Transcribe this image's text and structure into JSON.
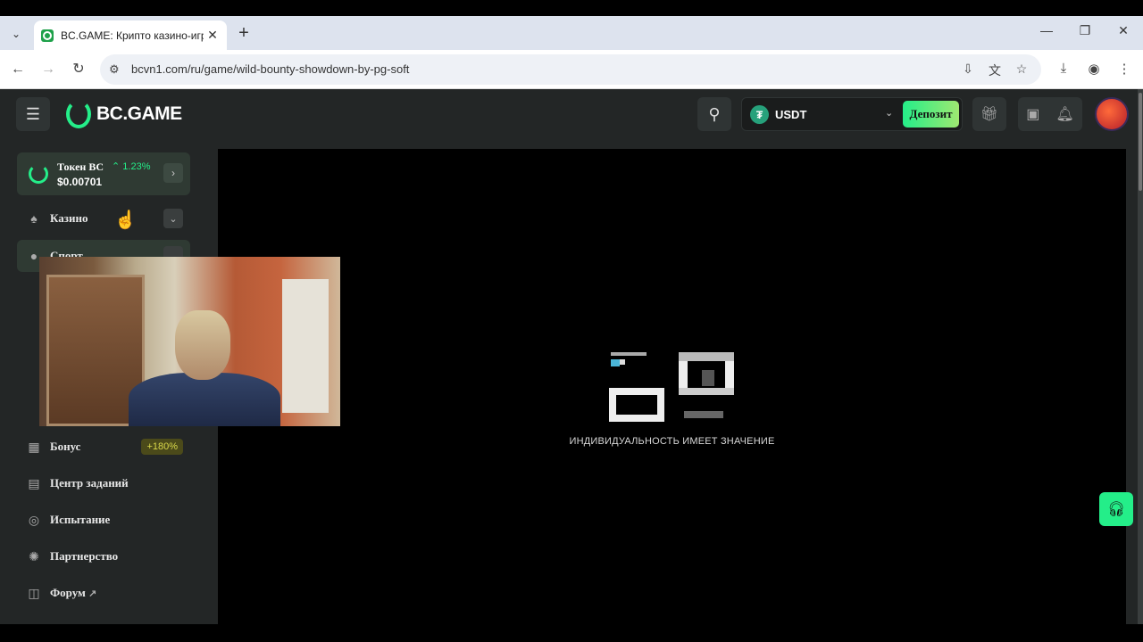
{
  "browser": {
    "tab": {
      "title": "BC.GAME: Крипто казино-игры",
      "close": "✕"
    },
    "new_tab": "+",
    "url": "bcvn1.com/ru/game/wild-bounty-showdown-by-pg-soft",
    "window_controls": {
      "minimize": "—",
      "restore": "❐",
      "close": "✕"
    }
  },
  "site": {
    "logo": "BC.GAME",
    "wallet": {
      "currency": "USDT",
      "deposit_label": "Депозит"
    },
    "token": {
      "name": "Токен BC",
      "change": "1.23%",
      "price": "$0.00701"
    },
    "nav": {
      "casino": "Казино",
      "sport": "Спорт",
      "bonus": "Бонус",
      "bonus_badge": "+180%",
      "task_center": "Центр заданий",
      "challenge": "Испытание",
      "partnership": "Партнерство",
      "forum": "Форум"
    },
    "game": {
      "loading_text": "ИНДИВИДУАЛЬНОСТЬ ИМЕЕТ ЗНАЧЕНИЕ"
    }
  },
  "colors": {
    "accent": "#24ee89",
    "background": "#232626",
    "usdt": "#26a17b"
  }
}
